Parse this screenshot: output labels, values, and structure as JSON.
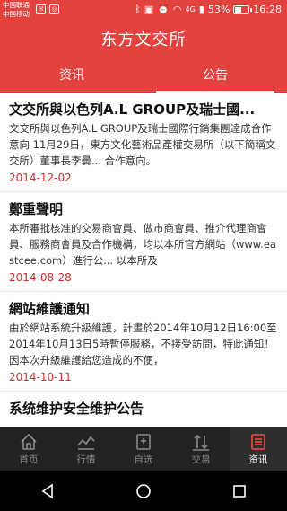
{
  "status_bar": {
    "carrier_1": "中国联通",
    "carrier_2": "中国移动",
    "network": "4G",
    "battery_percent": "53%",
    "battery_level": 0.53,
    "time": "16:28"
  },
  "app": {
    "title": "东方文交所"
  },
  "tabs": [
    {
      "label": "资讯",
      "active": false
    },
    {
      "label": "公告",
      "active": true
    }
  ],
  "announcements": [
    {
      "title": "文交所與以色列A.L GROUP及瑞士國...",
      "body": "文交所與以色列A.L GROUP及瑞士國際行銷集團達成合作意向 11月29日，東方文化藝術品產權交易所（以下簡稱文交所）董事長李曇... 合作意向。",
      "date": "2014-12-02"
    },
    {
      "title": "鄭重聲明",
      "body": "本所審批核准的交易商會員、做市商會員、推介代理商會員、服務商會員及合作機構，均以本所官方網站（www.eastcee.com）進行公... 以本所及",
      "date": "2014-08-28"
    },
    {
      "title": "網站維護通知",
      "body": "由於網站系統升級維護，計畫於2014年10月12日16:00至2014年10月13日5時暫停服務，不接受訪問，特此通知！ 因本次升級維護給您造成的不便，",
      "date": "2014-10-11"
    },
    {
      "title": "系统维护安全维护公告",
      "body": "",
      "date": ""
    }
  ],
  "bottom_nav": [
    {
      "label": "首页",
      "icon": "home-icon",
      "active": false
    },
    {
      "label": "行情",
      "icon": "chart-icon",
      "active": false
    },
    {
      "label": "自选",
      "icon": "favorite-icon",
      "active": false
    },
    {
      "label": "交易",
      "icon": "trade-icon",
      "active": false
    },
    {
      "label": "资讯",
      "icon": "news-icon",
      "active": true
    }
  ],
  "colors": {
    "brand_red": "#e2433e",
    "date_red": "#c9302c",
    "nav_dark": "#222222"
  }
}
